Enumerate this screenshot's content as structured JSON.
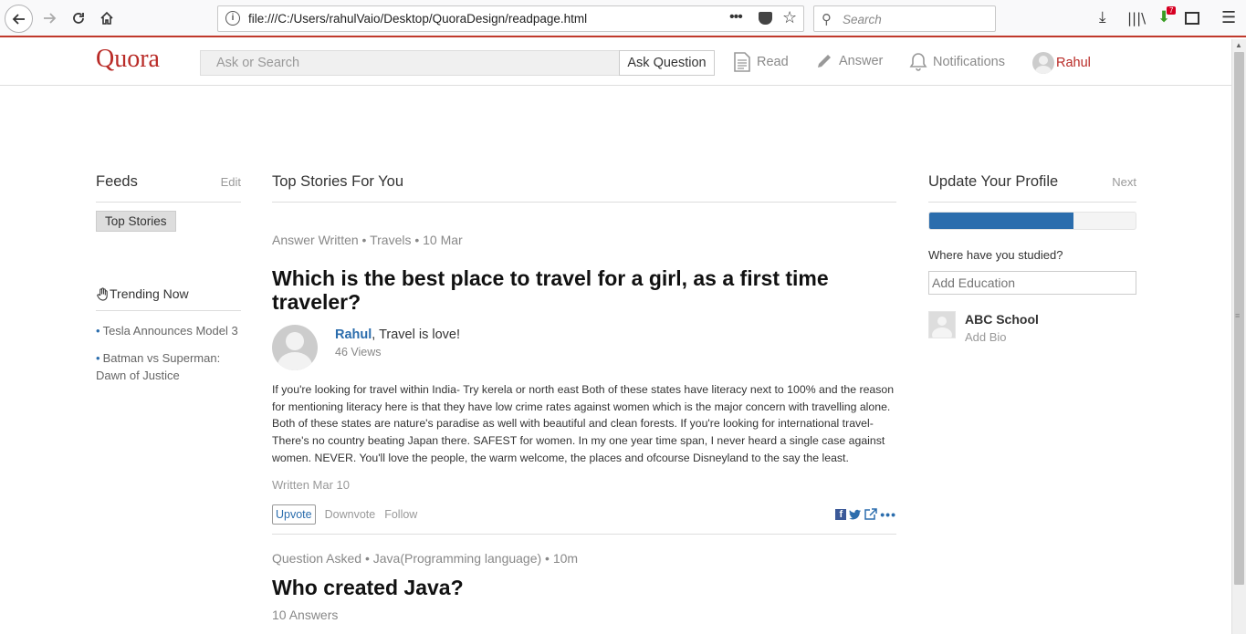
{
  "browser": {
    "url": "file:///C:/Users/rahulVaio/Desktop/QuoraDesign/readpage.html",
    "search_placeholder": "Search",
    "extension_badge": "7"
  },
  "header": {
    "logo": "Quora",
    "search_placeholder": "Ask or Search",
    "ask_label": "Ask Question",
    "nav": {
      "read": "Read",
      "answer": "Answer",
      "notifications": "Notifications",
      "user": "Rahul"
    },
    "colors": {
      "brand": "#b92b27",
      "link": "#2b6dad"
    }
  },
  "left": {
    "feeds_title": "Feeds",
    "edit_label": "Edit",
    "top_stories_label": "Top Stories",
    "trending_title": "Trending Now",
    "trending": [
      "Tesla Announces Model 3",
      "Batman vs Superman: Dawn of Justice"
    ]
  },
  "main": {
    "title": "Top Stories For You",
    "story1": {
      "meta": "Answer Written • Travels • 10 Mar",
      "question": "Which is the best place to travel for a girl, as a first time traveler?",
      "author": "Rahul",
      "credential": ", Travel is love!",
      "views": "46 Views",
      "body": "If you're looking for travel within India- Try kerela or north east Both of these states have literacy next to 100% and the reason for mentioning literacy here is that they have low crime rates against women which is the major concern with travelling alone. Both of these states are nature's paradise as well with beautiful and clean forests. If you're looking for international travel- There's no country beating Japan there. SAFEST for women. In my one year time span, I never heard a single case against women. NEVER. You'll love the people, the warm welcome, the places and ofcourse Disneyland to the say the least.",
      "written": "Written Mar 10",
      "upvote": "Upvote",
      "downvote": "Downvote",
      "follow": "Follow"
    },
    "story2": {
      "meta": "Question Asked • Java(Programming language) • 10m",
      "question": "Who created Java?",
      "answers": "10 Answers"
    }
  },
  "right": {
    "title": "Update Your Profile",
    "next_label": "Next",
    "progress": 0.7,
    "studied_label": "Where have you studied?",
    "education_placeholder": "Add Education",
    "school_name": "ABC School",
    "add_bio": "Add Bio"
  }
}
